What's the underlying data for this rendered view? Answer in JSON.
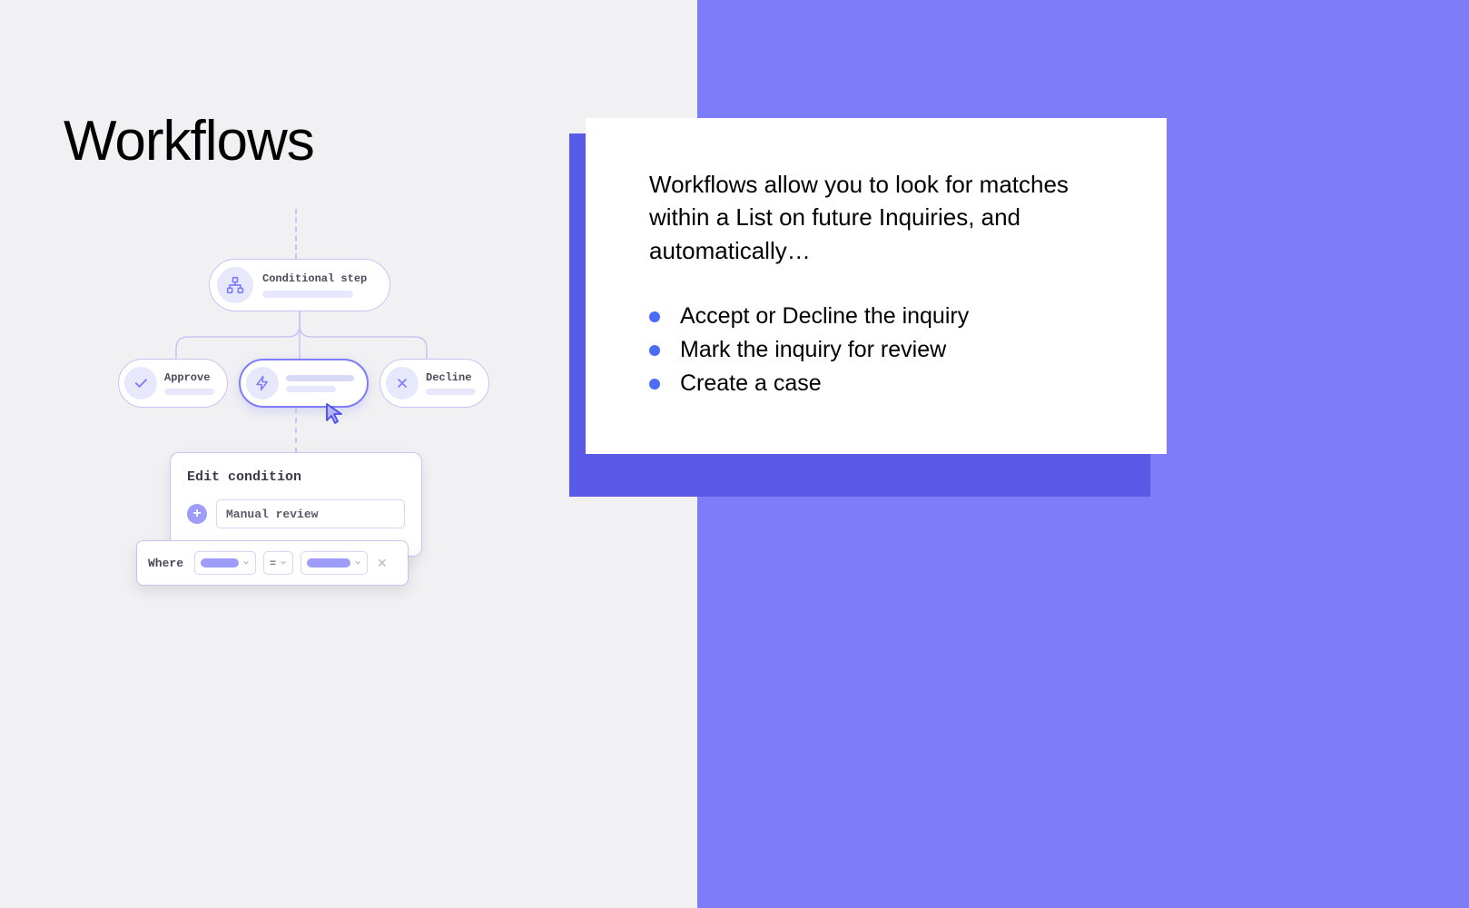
{
  "title": "Workflows",
  "diagram": {
    "conditional_label": "Conditional step",
    "approve_label": "Approve",
    "decline_label": "Decline",
    "edit_condition_title": "Edit condition",
    "manual_review_value": "Manual review",
    "where_label": "Where",
    "equals_symbol": "="
  },
  "info": {
    "description": "Workflows allow you to look for matches within a List on future Inquiries, and automatically…",
    "bullets": [
      "Accept or Decline the inquiry",
      "Mark the inquiry for review",
      "Create a case"
    ]
  },
  "colors": {
    "accent": "#7d7df9",
    "light_accent": "#e8e8fc",
    "bullet": "#4a6cf7"
  }
}
